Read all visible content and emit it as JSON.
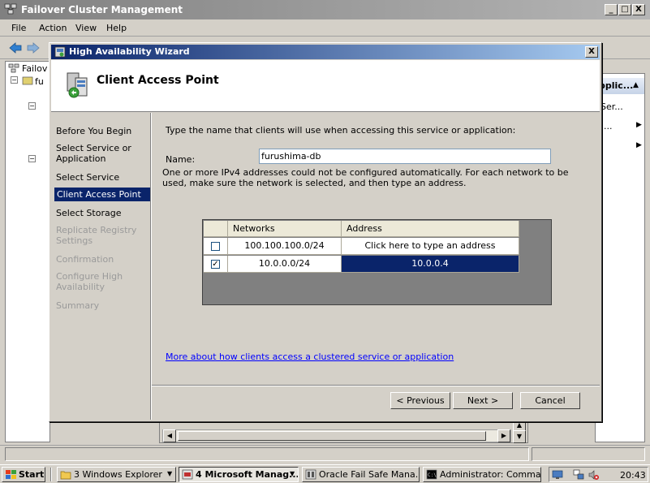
{
  "main_window": {
    "title": "Failover Cluster Management",
    "min_symbol": "_",
    "max_symbol": "□",
    "close_symbol": "X",
    "menu": [
      "File",
      "Action",
      "View",
      "Help"
    ],
    "tree_items": [
      "Failov",
      "fu"
    ],
    "actions_header": "pplic...",
    "actions_items": [
      "Ser...",
      "..."
    ]
  },
  "wizard": {
    "title": "High Availability Wizard",
    "close_symbol": "X",
    "header_title": "Client Access Point",
    "steps": [
      {
        "label": "Before You Begin",
        "state": "normal"
      },
      {
        "label": "Select Service or Application",
        "state": "normal"
      },
      {
        "label": "Select Service",
        "state": "normal"
      },
      {
        "label": "Client Access Point",
        "state": "active"
      },
      {
        "label": "Select Storage",
        "state": "normal"
      },
      {
        "label": "Replicate Registry Settings",
        "state": "disabled"
      },
      {
        "label": "Confirmation",
        "state": "disabled"
      },
      {
        "label": "Configure High Availability",
        "state": "disabled"
      },
      {
        "label": "Summary",
        "state": "disabled"
      }
    ],
    "instruction": "Type the name that clients will use when accessing this service or application:",
    "name_label": "Name:",
    "name_value": "furushima-db",
    "ipv4_note": "One or more IPv4 addresses could not be configured automatically.  For each network to be used, make sure the network is selected, and then type an address.",
    "table": {
      "headers": [
        "Networks",
        "Address"
      ],
      "rows": [
        {
          "checked": false,
          "network": "100.100.100.0/24",
          "address": "Click here to type an address",
          "selected": false
        },
        {
          "checked": true,
          "network": "10.0.0.0/24",
          "address": "10.0.0.4",
          "selected": true
        }
      ]
    },
    "check_mark": "✓",
    "more_link": "More about how clients access a clustered service or application",
    "buttons": {
      "previous": "< Previous",
      "next": "Next >",
      "cancel": "Cancel"
    }
  },
  "taskbar": {
    "start": "Start",
    "tasks": [
      {
        "label": "3 Windows Explorer",
        "pressed": false
      },
      {
        "label": "4 Microsoft Manag...",
        "pressed": true
      },
      {
        "label": "Oracle Fail Safe Mana...",
        "pressed": false
      },
      {
        "label": "Administrator: Comma...",
        "pressed": false
      }
    ],
    "clock": "20:43"
  }
}
